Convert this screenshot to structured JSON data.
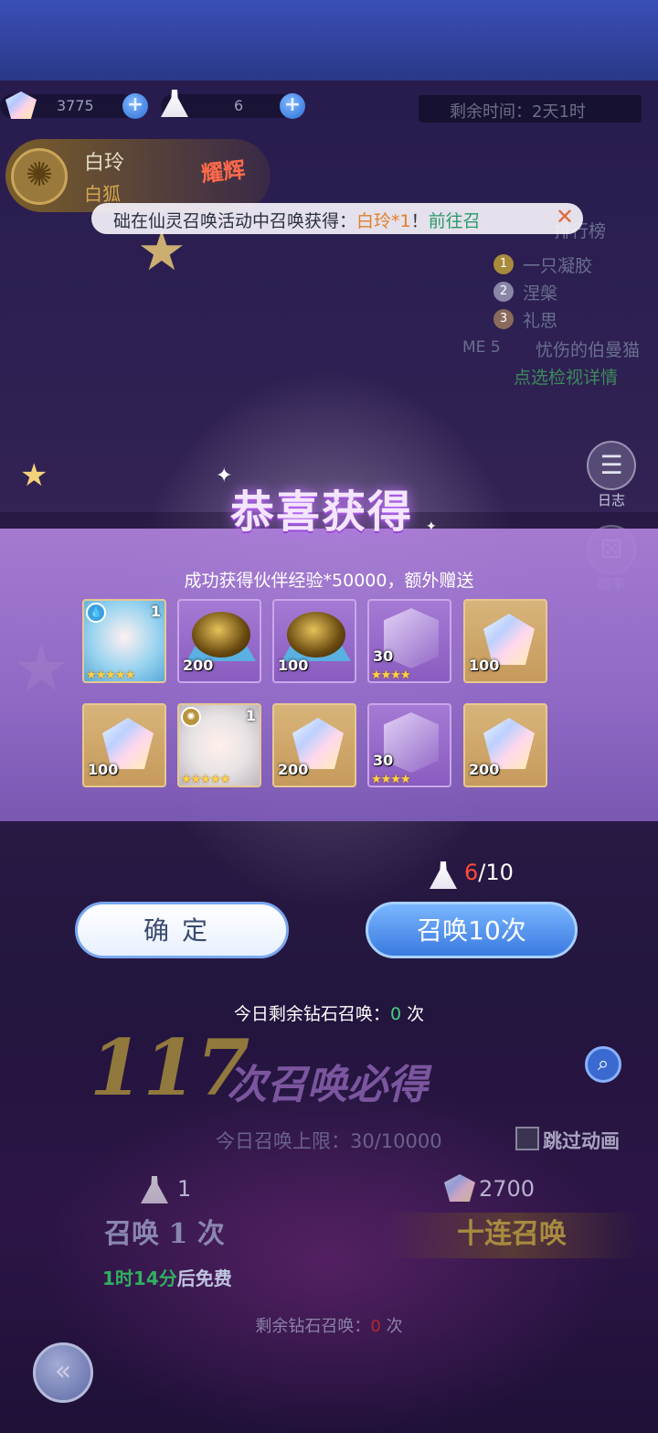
{
  "resources": {
    "gems": "3775",
    "dresses": "6"
  },
  "timer": "剩余时间：2天1时",
  "character": {
    "name": "白玲",
    "subtitle": "白狐",
    "tag": "耀辉"
  },
  "notice": {
    "prefix": "础在仙灵召唤活动中召唤获得：",
    "highlight": "白玲*1",
    "suffix": "！",
    "link": "前往召"
  },
  "ranking": {
    "title": "排行榜",
    "entries": [
      {
        "rank": "1",
        "name": "一只凝胶"
      },
      {
        "rank": "2",
        "name": "涅槃"
      },
      {
        "rank": "3",
        "name": "礼思"
      },
      {
        "rank": "ME 5",
        "name": "忧伤的伯曼猫"
      }
    ],
    "link": "点选检视详情"
  },
  "side": {
    "log": "日志",
    "rate": "概率"
  },
  "modal": {
    "title": "恭喜获得",
    "subtitle": "成功获得伙伴经验*50000，额外赠送",
    "items": [
      {
        "type": "character",
        "qty": "",
        "count": "1",
        "stars": "★★★★★",
        "frame": "gold"
      },
      {
        "type": "egg",
        "qty": "200",
        "count": "",
        "stars": "",
        "frame": "purple"
      },
      {
        "type": "egg",
        "qty": "100",
        "count": "",
        "stars": "",
        "frame": "purple"
      },
      {
        "type": "cube",
        "qty": "30",
        "count": "",
        "stars": "★★★★",
        "frame": "purple"
      },
      {
        "type": "gem",
        "qty": "100",
        "count": "",
        "stars": "",
        "frame": "gold"
      },
      {
        "type": "gem",
        "qty": "100",
        "count": "",
        "stars": "",
        "frame": "gold"
      },
      {
        "type": "character",
        "qty": "",
        "count": "1",
        "stars": "★★★★★",
        "frame": "gold"
      },
      {
        "type": "gem",
        "qty": "200",
        "count": "",
        "stars": "",
        "frame": "gold"
      },
      {
        "type": "cube",
        "qty": "30",
        "count": "",
        "stars": "★★★★",
        "frame": "purple"
      },
      {
        "type": "gem",
        "qty": "200",
        "count": "",
        "stars": "",
        "frame": "gold"
      }
    ]
  },
  "counter": {
    "current": "6",
    "total": "/10"
  },
  "buttons": {
    "confirm": "确定",
    "summon10": "召唤10次"
  },
  "today_left": {
    "prefix": "今日剩余钻石召唤：",
    "value": "0",
    "suffix": " 次"
  },
  "background": {
    "pity_number": "117",
    "pity_text": "次召唤必得",
    "limit_prefix": "今日召唤上限：",
    "limit_value": "30/10000",
    "skip_label": "跳过动画",
    "cost_single": "1",
    "cost_ten": "2700",
    "summon_single": "召唤 1 次",
    "summon_ten": "十连召唤",
    "free_time": "1时14分",
    "free_suffix": "后免费",
    "remain_prefix": "剩余钻石召唤：",
    "remain_value": "0",
    "remain_suffix": " 次"
  },
  "colors": {
    "accent_gold": "#d4a850",
    "accent_blue": "#3a7ae0",
    "highlight_red": "#ff4a3a",
    "green": "#40d080"
  }
}
